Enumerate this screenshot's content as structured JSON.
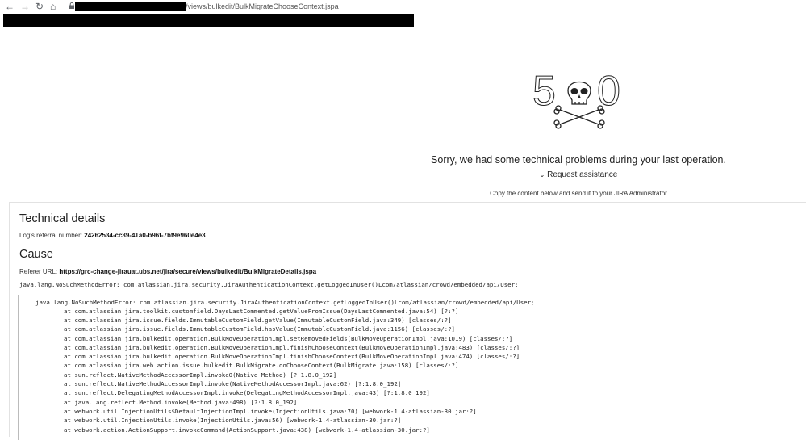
{
  "browser": {
    "url_path": "/views/bulkedit/BulkMigrateChooseContext.jspa",
    "icons": [
      "back-arrow-icon",
      "forward-arrow-icon",
      "reload-icon",
      "home-icon",
      "lock-icon"
    ]
  },
  "error": {
    "code_left": "5",
    "code_right": "0",
    "message": "Sorry, we had some technical problems during your last operation.",
    "request_assistance": "Request assistance",
    "copy_instruction": "Copy the content below and send it to your JIRA Administrator"
  },
  "technical": {
    "title": "Technical details",
    "referral_label": "Log's referral number:",
    "referral_number": "24262534-cc39-41a0-b96f-7bf9e960e4e3"
  },
  "cause": {
    "title": "Cause",
    "referer_label": "Referer URL:",
    "referer_url": "https://grc-change-jirauat.ubs.net/jira/secure/views/bulkedit/BulkMigrateDetails.jspa",
    "exception": "java.lang.NoSuchMethodError: com.atlassian.jira.security.JiraAuthenticationContext.getLoggedInUser()Lcom/atlassian/crowd/embedded/api/User;"
  },
  "stacktrace": [
    "java.lang.NoSuchMethodError: com.atlassian.jira.security.JiraAuthenticationContext.getLoggedInUser()Lcom/atlassian/crowd/embedded/api/User;",
    "at com.atlassian.jira.toolkit.customfield.DaysLastCommented.getValueFromIssue(DaysLastCommented.java:54) [?:?]",
    "at com.atlassian.jira.issue.fields.ImmutableCustomField.getValue(ImmutableCustomField.java:349) [classes/:?]",
    "at com.atlassian.jira.issue.fields.ImmutableCustomField.hasValue(ImmutableCustomField.java:1156) [classes/:?]",
    "at com.atlassian.jira.bulkedit.operation.BulkMoveOperationImpl.setRemovedFields(BulkMoveOperationImpl.java:1019) [classes/:?]",
    "at com.atlassian.jira.bulkedit.operation.BulkMoveOperationImpl.finishChooseContext(BulkMoveOperationImpl.java:483) [classes/:?]",
    "at com.atlassian.jira.bulkedit.operation.BulkMoveOperationImpl.finishChooseContext(BulkMoveOperationImpl.java:474) [classes/:?]",
    "at com.atlassian.jira.web.action.issue.bulkedit.BulkMigrate.doChooseContext(BulkMigrate.java:158) [classes/:?]",
    "at sun.reflect.NativeMethodAccessorImpl.invoke0(Native Method) [?:1.8.0_192]",
    "at sun.reflect.NativeMethodAccessorImpl.invoke(NativeMethodAccessorImpl.java:62) [?:1.8.0_192]",
    "at sun.reflect.DelegatingMethodAccessorImpl.invoke(DelegatingMethodAccessorImpl.java:43) [?:1.8.0_192]",
    "at java.lang.reflect.Method.invoke(Method.java:498) [?:1.8.0_192]",
    "at webwork.util.InjectionUtils$DefaultInjectionImpl.invoke(InjectionUtils.java:70) [webwork-1.4-atlassian-30.jar:?]",
    "at webwork.util.InjectionUtils.invoke(InjectionUtils.java:56) [webwork-1.4-atlassian-30.jar:?]",
    "at webwork.action.ActionSupport.invokeCommand(ActionSupport.java:438) [webwork-1.4-atlassian-30.jar:?]"
  ]
}
